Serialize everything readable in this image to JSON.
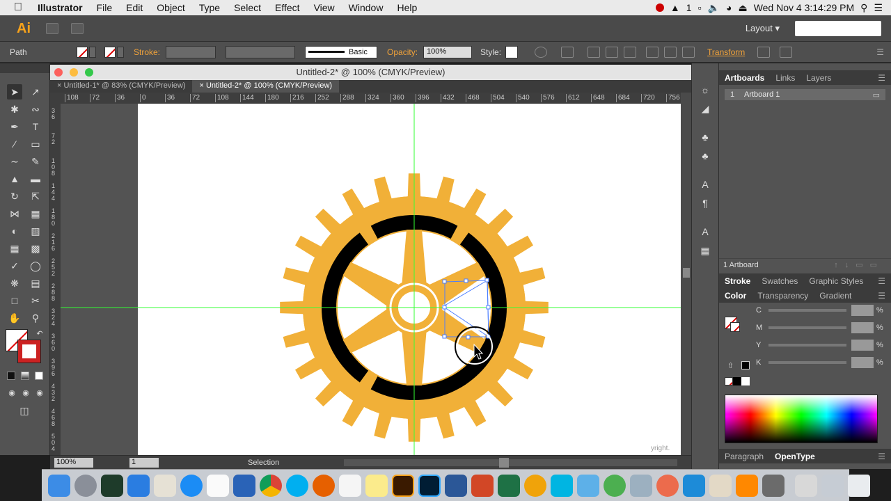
{
  "menubar": {
    "app_name": "Illustrator",
    "items": [
      "File",
      "Edit",
      "Object",
      "Type",
      "Select",
      "Effect",
      "View",
      "Window",
      "Help"
    ],
    "status_a": "1",
    "clock": "Wed Nov 4  3:14:29 PM"
  },
  "appbar": {
    "logo": "Ai",
    "workspace": "Layout"
  },
  "controlbar": {
    "selection_type": "Path",
    "stroke_label": "Stroke:",
    "brush_label": "Basic",
    "opacity_label": "Opacity:",
    "opacity_value": "100%",
    "style_label": "Style:",
    "transform_label": "Transform"
  },
  "document": {
    "window_title": "Untitled-2* @ 100% (CMYK/Preview)",
    "tabs": [
      {
        "label": "Untitled-1* @ 83% (CMYK/Preview)",
        "active": false
      },
      {
        "label": "Untitled-2* @ 100% (CMYK/Preview)",
        "active": true
      }
    ],
    "ruler_h": [
      "108",
      "72",
      "36",
      "0",
      "36",
      "72",
      "108",
      "144",
      "180",
      "216",
      "252",
      "288",
      "324",
      "360",
      "396",
      "432",
      "468",
      "504",
      "540",
      "576",
      "612",
      "648",
      "684",
      "720",
      "756"
    ],
    "ruler_v": [
      "3 6",
      "7 2",
      "1 0 8",
      "1 4 4",
      "1 8 0",
      "2 1 6",
      "2 5 2",
      "2 8 8",
      "3 2 4",
      "3 6 0",
      "3 9 6",
      "4 3 2",
      "4 6 8",
      "5 0 4"
    ],
    "gear_color": "#f1b038",
    "ring_color": "#000000",
    "guide_color": "#33ff33"
  },
  "statusbar": {
    "zoom": "100%",
    "artboard_num": "1",
    "tool_mode": "Selection"
  },
  "panels": {
    "artboards_tabs": [
      "Artboards",
      "Links",
      "Layers"
    ],
    "artboard_rows": [
      {
        "num": "1",
        "name": "Artboard 1"
      }
    ],
    "artboard_count": "1 Artboard",
    "stroke_tabs": [
      "Stroke",
      "Swatches",
      "Graphic Styles"
    ],
    "color_tabs": [
      "Color",
      "Transparency",
      "Gradient"
    ],
    "cmyk": [
      "C",
      "M",
      "Y",
      "K"
    ],
    "percent": "%",
    "text_tabs": [
      "Paragraph",
      "OpenType"
    ],
    "copyright_fragment": "yright."
  }
}
